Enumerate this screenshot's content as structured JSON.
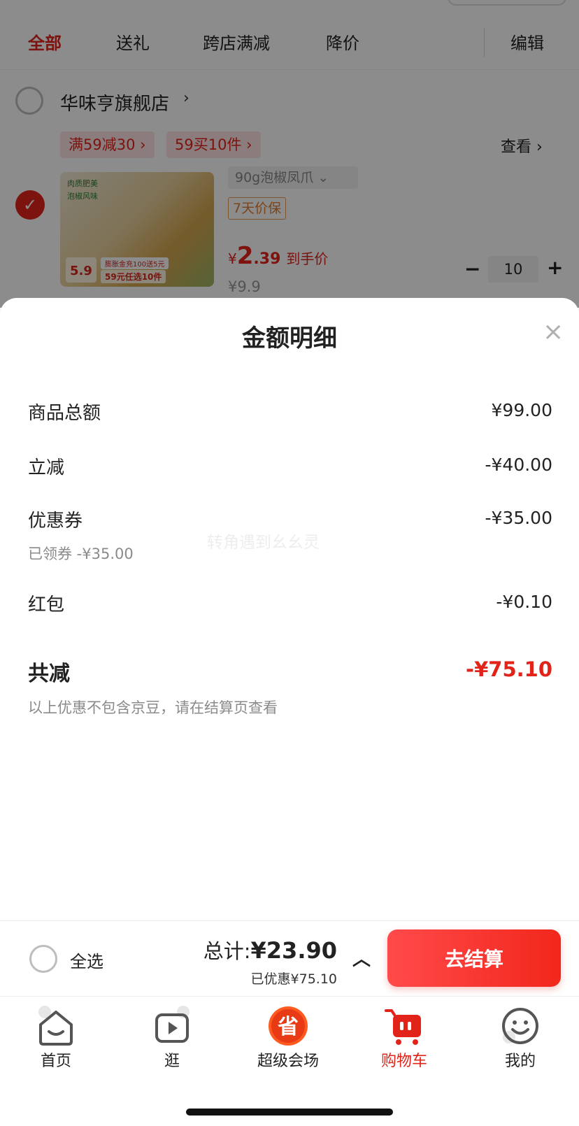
{
  "tabs": [
    {
      "label": "全部",
      "active": true
    },
    {
      "label": "送礼"
    },
    {
      "label": "跨店满减"
    },
    {
      "label": "降价"
    }
  ],
  "edit_label": "编辑",
  "store": {
    "name": "华味亨旗舰店",
    "promos": [
      "满59减30 ›",
      "59买10件 ›"
    ],
    "view_label": "查看 ›"
  },
  "product": {
    "image_tags": [
      "肉质肥美",
      "泡椒风味"
    ],
    "image_badge": "5.9",
    "image_strip1": "膨胀金充100送5元",
    "image_strip2": "59元任选10件",
    "spec": "90g泡椒凤爪 ⌄",
    "guarantee": "7天价保",
    "price_yen": "¥",
    "price_int": "2",
    "price_dec": ".39",
    "price_note": "到手价",
    "original_price": "¥9.9",
    "quantity": "10"
  },
  "detail": {
    "title": "金额明细",
    "close_icon": "×",
    "watermark": "转角遇到幺幺灵",
    "lines": [
      {
        "label": "商品总额",
        "value": "¥99.00"
      },
      {
        "label": "立减",
        "value": "-¥40.00"
      },
      {
        "label": "优惠券",
        "value": "-¥35.00",
        "sub": "已领券 -¥35.00"
      },
      {
        "label": "红包",
        "value": "-¥0.10"
      }
    ],
    "total_label": "共减",
    "total_value": "-¥75.10",
    "note": "以上优惠不包含京豆，请在结算页查看"
  },
  "checkout": {
    "select_all": "全选",
    "total_prefix": "总计:",
    "total_amount": "¥23.90",
    "saved": "已优惠¥75.10",
    "button": "去结算"
  },
  "nav": [
    {
      "label": "首页",
      "icon": "home-icon"
    },
    {
      "label": "逛",
      "icon": "video-icon"
    },
    {
      "label": "超级会场",
      "icon": "super-venue-icon"
    },
    {
      "label": "购物车",
      "icon": "cart-icon",
      "active": true
    },
    {
      "label": "我的",
      "icon": "profile-icon"
    }
  ],
  "colors": {
    "accent": "#e2231a",
    "price_guard": "#e07a2a"
  }
}
